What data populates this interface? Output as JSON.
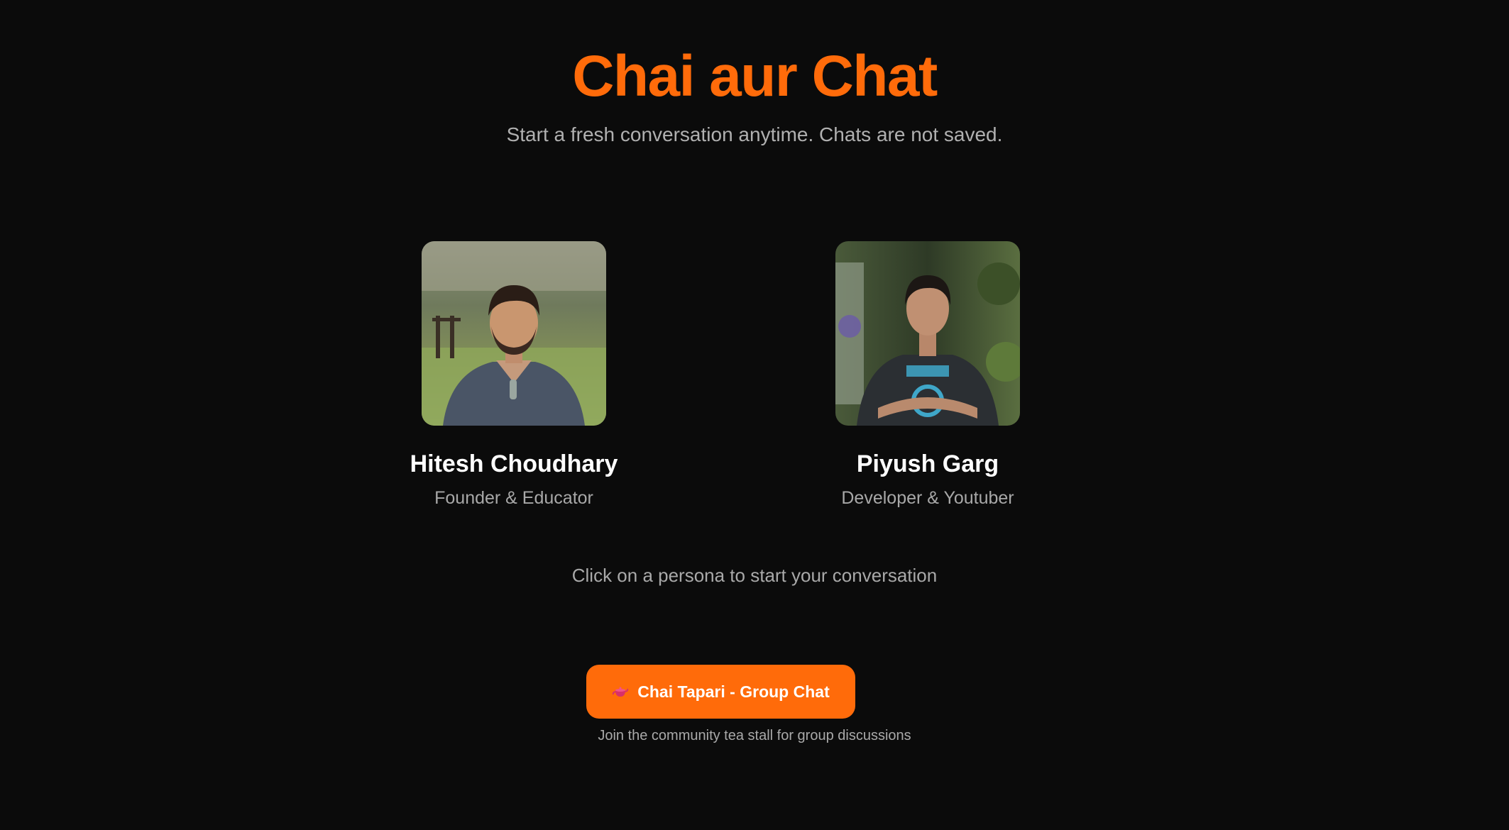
{
  "header": {
    "title": "Chai aur Chat",
    "subtitle": "Start a fresh conversation anytime. Chats are not saved."
  },
  "personas": [
    {
      "name": "Hitesh Choudhary",
      "role": "Founder & Educator"
    },
    {
      "name": "Piyush Garg",
      "role": "Developer & Youtuber"
    }
  ],
  "hint": "Click on a persona to start your conversation",
  "group_chat": {
    "icon": "teapot-icon",
    "label": "Chai Tapari - Group Chat",
    "caption": "Join the community tea stall for group discussions"
  },
  "colors": {
    "accent": "#ff6b0a",
    "background": "#0b0b0b"
  }
}
